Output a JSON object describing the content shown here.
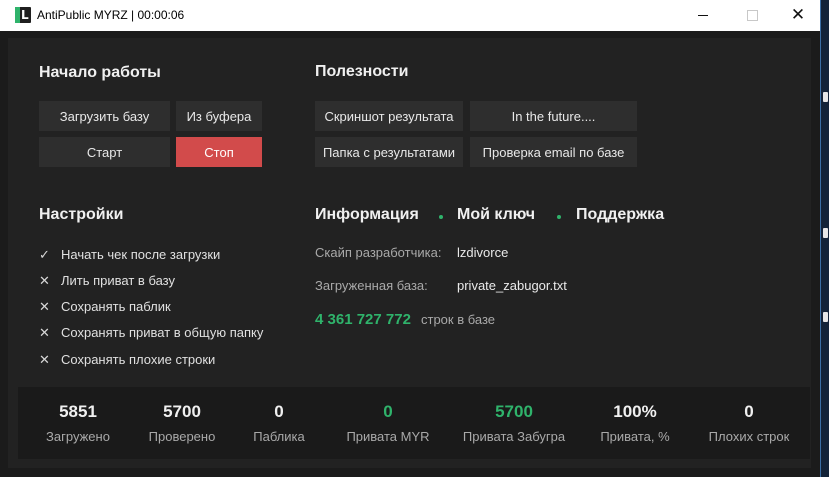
{
  "window": {
    "title": "AntiPublic MYRZ | 00:00:06",
    "icon_letter": "L",
    "controls": {
      "close_glyph": "✕"
    }
  },
  "start": {
    "heading": "Начало работы",
    "load_db": "Загрузить базу",
    "from_clipboard": "Из буфера",
    "start": "Старт",
    "stop": "Стоп"
  },
  "utilities": {
    "heading": "Полезности",
    "screenshot": "Скриншот результата",
    "future": "In the future....",
    "results_folder": "Папка с результатами",
    "email_check": "Проверка email по базе"
  },
  "settings": {
    "heading": "Настройки",
    "options": [
      {
        "mark": "✓",
        "label": "Начать чек после загрузки"
      },
      {
        "mark": "✕",
        "label": "Лить приват в базу"
      },
      {
        "mark": "✕",
        "label": "Сохранять паблик"
      },
      {
        "mark": "✕",
        "label": "Сохранять приват в общую папку"
      },
      {
        "mark": "✕",
        "label": "Сохранять плохие строки"
      }
    ]
  },
  "info": {
    "tabs": [
      "Информация",
      "Мой ключ",
      "Поддержка"
    ],
    "skype_label": "Скайп разработчика:",
    "skype_value": "lzdivorce",
    "db_label": "Загруженная база:",
    "db_value": "private_zabugor.txt",
    "lines_count": "4 361 727 772",
    "lines_label": "строк в базе"
  },
  "stats": [
    {
      "value": "5851",
      "label": "Загружено"
    },
    {
      "value": "5700",
      "label": "Проверено"
    },
    {
      "value": "0",
      "label": "Паблика"
    },
    {
      "value": "0",
      "label": "Привата MYR"
    },
    {
      "value": "5700",
      "label": "Привата Забугра"
    },
    {
      "value": "100%",
      "label": "Привата, %"
    },
    {
      "value": "0",
      "label": "Плохих строк"
    }
  ],
  "colors": {
    "accent": "#2fb36b",
    "stop": "#d24b4b",
    "background": "#222222"
  }
}
